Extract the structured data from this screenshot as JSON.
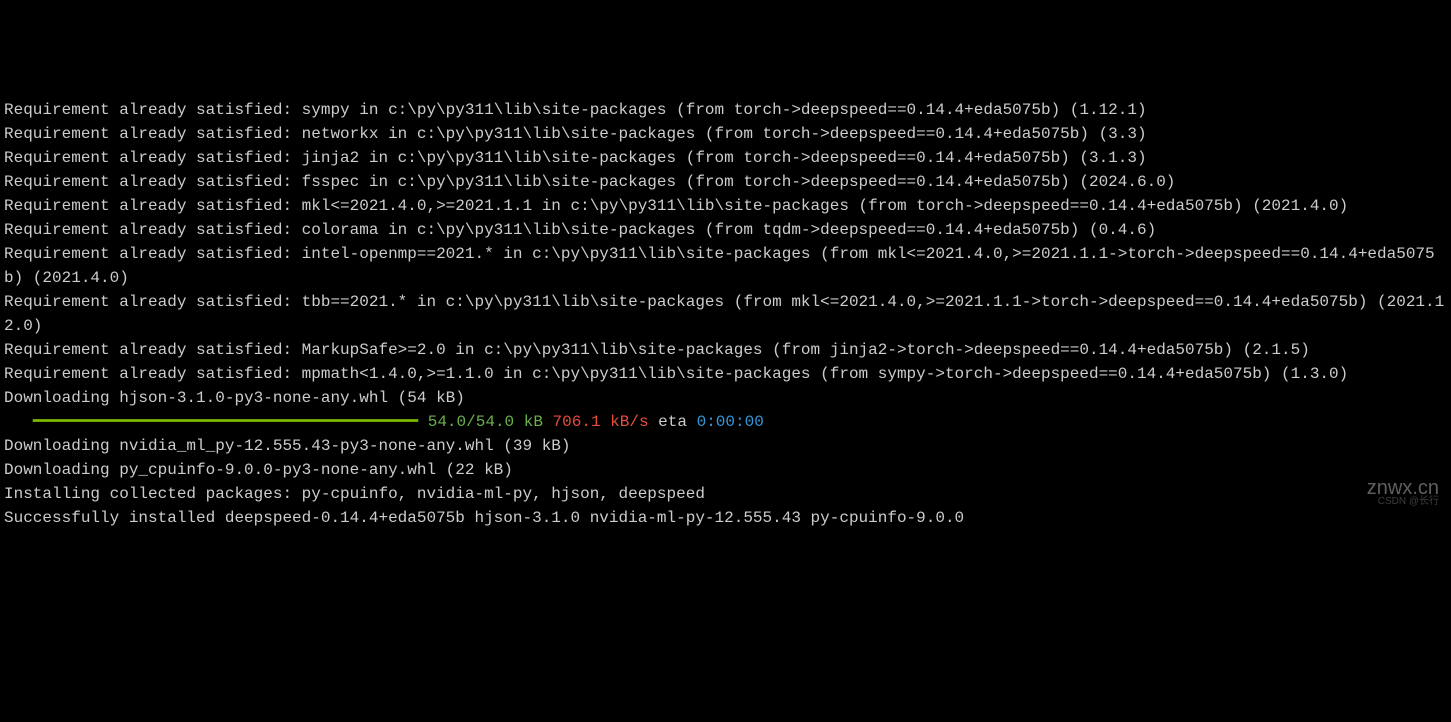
{
  "lines": {
    "l1": "Requirement already satisfied: sympy in c:\\py\\py311\\lib\\site-packages (from torch->deepspeed==0.14.4+eda5075b) (1.12.1)",
    "l2": "Requirement already satisfied: networkx in c:\\py\\py311\\lib\\site-packages (from torch->deepspeed==0.14.4+eda5075b) (3.3)",
    "l3": "Requirement already satisfied: jinja2 in c:\\py\\py311\\lib\\site-packages (from torch->deepspeed==0.14.4+eda5075b) (3.1.3)",
    "l4": "Requirement already satisfied: fsspec in c:\\py\\py311\\lib\\site-packages (from torch->deepspeed==0.14.4+eda5075b) (2024.6.0)",
    "l5": "Requirement already satisfied: mkl<=2021.4.0,>=2021.1.1 in c:\\py\\py311\\lib\\site-packages (from torch->deepspeed==0.14.4+eda5075b) (2021.4.0)",
    "l6": "Requirement already satisfied: colorama in c:\\py\\py311\\lib\\site-packages (from tqdm->deepspeed==0.14.4+eda5075b) (0.4.6)",
    "l7": "Requirement already satisfied: intel-openmp==2021.* in c:\\py\\py311\\lib\\site-packages (from mkl<=2021.4.0,>=2021.1.1->torch->deepspeed==0.14.4+eda5075b) (2021.4.0)",
    "l8": "Requirement already satisfied: tbb==2021.* in c:\\py\\py311\\lib\\site-packages (from mkl<=2021.4.0,>=2021.1.1->torch->deepspeed==0.14.4+eda5075b) (2021.12.0)",
    "l9": "Requirement already satisfied: MarkupSafe>=2.0 in c:\\py\\py311\\lib\\site-packages (from jinja2->torch->deepspeed==0.14.4+eda5075b) (2.1.5)",
    "l10": "Requirement already satisfied: mpmath<1.4.0,>=1.1.0 in c:\\py\\py311\\lib\\site-packages (from sympy->torch->deepspeed==0.14.4+eda5075b) (1.3.0)",
    "l11": "Downloading hjson-3.1.0-py3-none-any.whl (54 kB)",
    "progress_bar": "   ━━━━━━━━━━━━━━━━━━━━━━━━━━━━━━━━━━━━━━━━",
    "progress_size": " 54.0/54.0 kB",
    "progress_speed": " 706.1 kB/s",
    "progress_eta_label": " eta ",
    "progress_time": "0:00:00",
    "l13": "Downloading nvidia_ml_py-12.555.43-py3-none-any.whl (39 kB)",
    "l14": "Downloading py_cpuinfo-9.0.0-py3-none-any.whl (22 kB)",
    "l15": "Installing collected packages: py-cpuinfo, nvidia-ml-py, hjson, deepspeed",
    "l16": "Successfully installed deepspeed-0.14.4+eda5075b hjson-3.1.0 nvidia-ml-py-12.555.43 py-cpuinfo-9.0.0"
  },
  "watermark": {
    "main": "znwx.cn",
    "sub": "CSDN @长行"
  }
}
